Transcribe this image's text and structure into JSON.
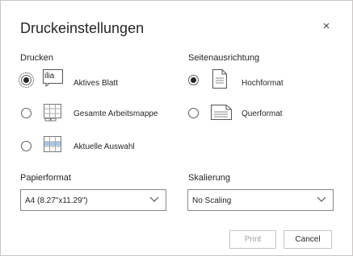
{
  "dialog": {
    "title": "Druckeinstellungen",
    "close_glyph": "×"
  },
  "print_section": {
    "label": "Drucken",
    "options": [
      {
        "label": "Aktives Blatt",
        "selected": true,
        "icon": "active-sheet-icon",
        "icon_text": "ilia"
      },
      {
        "label": "Gesamte Arbeitsmappe",
        "selected": false,
        "icon": "workbook-icon"
      },
      {
        "label": "Aktuelle Auswahl",
        "selected": false,
        "icon": "selection-grid-icon"
      }
    ]
  },
  "orientation_section": {
    "label": "Seitenausrichtung",
    "options": [
      {
        "label": "Hochformat",
        "selected": true,
        "icon": "portrait-page-icon"
      },
      {
        "label": "Querformat",
        "selected": false,
        "icon": "landscape-page-icon"
      }
    ]
  },
  "paper": {
    "label": "Papierformat",
    "value": "A4 (8.27\"x11.29\")"
  },
  "scaling": {
    "label": "Skalierung",
    "value": "No Scaling"
  },
  "buttons": {
    "print": "Print",
    "cancel": "Cancel"
  },
  "colors": {
    "selection_blue": "#5b9bd5",
    "border": "#8a8886",
    "disabled_text": "#a19f9d"
  }
}
